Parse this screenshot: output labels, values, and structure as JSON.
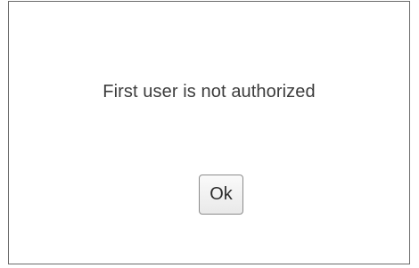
{
  "dialog": {
    "message": "First user is not authorized",
    "ok_label": "Ok"
  }
}
